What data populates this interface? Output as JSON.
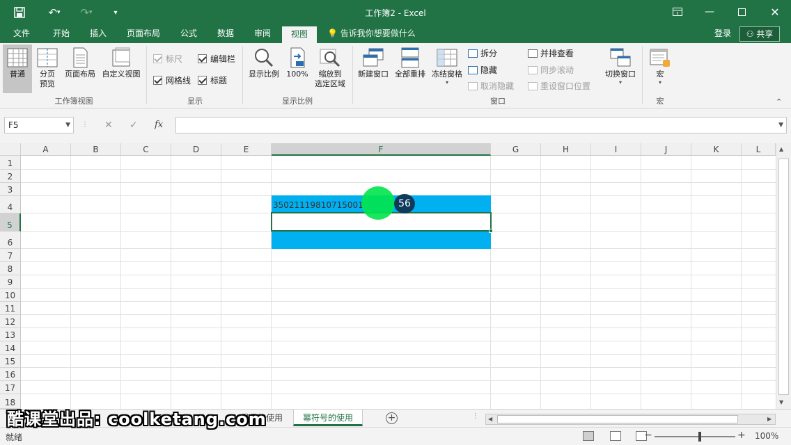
{
  "app": {
    "title": "工作簿2 - Excel"
  },
  "quick_access": [
    "save-icon",
    "undo-icon",
    "redo-icon",
    "customize-icon"
  ],
  "window_controls": [
    "ribbon-display-icon",
    "minimize-icon",
    "maximize-icon",
    "close-icon"
  ],
  "tabs": [
    "文件",
    "开始",
    "插入",
    "页面布局",
    "公式",
    "数据",
    "审阅",
    "视图"
  ],
  "active_tab": "视图",
  "tell_me": "告诉我你想要做什么",
  "account": {
    "login": "登录",
    "share": "共享"
  },
  "ribbon": {
    "workbook_views": {
      "label": "工作簿视图",
      "buttons": [
        "普通",
        "分页\n预览",
        "页面布局",
        "自定义视图"
      ]
    },
    "show": {
      "label": "显示",
      "ruler": "标尺",
      "formula_bar": "编辑栏",
      "gridlines": "网格线",
      "headings": "标题"
    },
    "zoom": {
      "label": "显示比例",
      "zoom": "显示比例",
      "hundred": "100%",
      "to_selection": "缩放到\n选定区域"
    },
    "window": {
      "label": "窗口",
      "new_window": "新建窗口",
      "arrange_all": "全部重排",
      "freeze": "冻结窗格",
      "split": "拆分",
      "hide": "隐藏",
      "unhide": "取消隐藏",
      "side_by_side": "并排查看",
      "sync_scroll": "同步滚动",
      "reset_position": "重设窗口位置",
      "switch": "切换窗口"
    },
    "macros": {
      "label": "宏",
      "button": "宏"
    }
  },
  "formula_bar": {
    "name_box": "F5",
    "formula": ""
  },
  "columns": [
    "A",
    "B",
    "C",
    "D",
    "E",
    "F",
    "G",
    "H",
    "I",
    "J",
    "K",
    "L"
  ],
  "rows": [
    "1",
    "2",
    "3",
    "4",
    "5",
    "6",
    "7",
    "8",
    "9",
    "10",
    "11",
    "12",
    "13",
    "14",
    "15",
    "16",
    "17",
    "18"
  ],
  "cells": {
    "F4": "35021119810715001"
  },
  "fill_color": "#00b0f0",
  "accent_color": "#217346",
  "cursor_badge": "56",
  "sheet_tabs": [
    "星号的使用",
    "幂符号的使用"
  ],
  "active_sheet": "幂符号的使用",
  "status": {
    "text": "就绪",
    "zoom": "100%"
  },
  "watermark": "酷课堂出品: coolketang.com"
}
